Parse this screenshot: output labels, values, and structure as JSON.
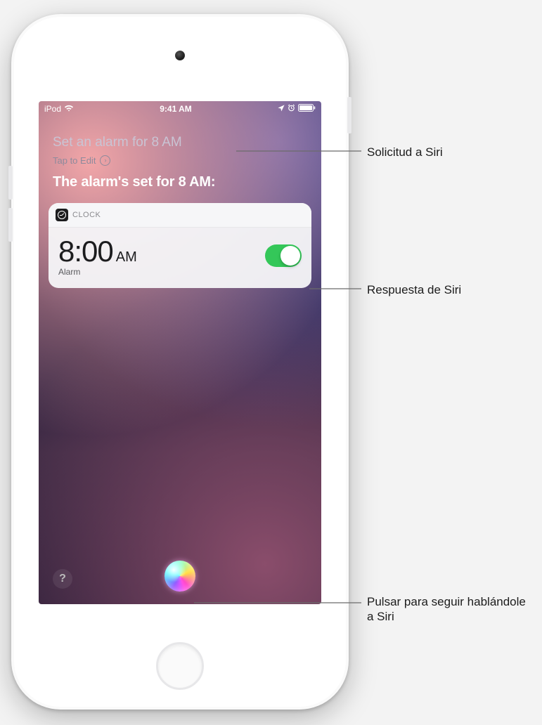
{
  "statusbar": {
    "carrier": "iPod",
    "time": "9:41 AM",
    "wifi_icon": "wifi-icon",
    "loc_icon": "location-icon",
    "alarm_icon": "alarm-indicator-icon",
    "battery_icon": "battery-icon"
  },
  "siri": {
    "request": "Set an alarm for 8 AM",
    "tap_to_edit": "Tap to Edit",
    "response": "The alarm's set for 8 AM:"
  },
  "card": {
    "app": "CLOCK",
    "time": "8:00",
    "suffix": "AM",
    "label": "Alarm",
    "toggle_on": true
  },
  "help_label": "?",
  "callouts": {
    "request": "Solicitud a Siri",
    "response": "Respuesta de Siri",
    "orb": "Pulsar para seguir hablándole a Siri"
  }
}
